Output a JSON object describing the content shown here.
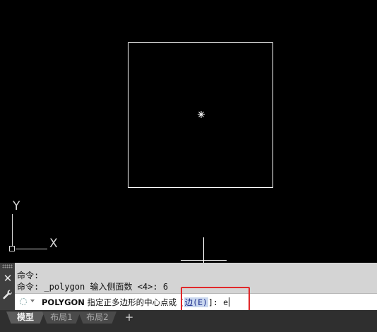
{
  "canvas": {
    "background": "#000000",
    "axis_x_label": "X",
    "axis_y_label": "Y",
    "stroke_color": "#ffffff"
  },
  "command_panel": {
    "history": [
      "命令:",
      "命令: _polygon 输入侧面数 <4>: 6"
    ],
    "prompt": {
      "command": "POLYGON",
      "text": "指定正多边形的中心点或",
      "bracket_open": "[",
      "option_label": "边",
      "option_key": "(E)",
      "bracket_close": "]:",
      "typed": "e"
    },
    "highlight_color": "#e0282a"
  },
  "layout_tabs": {
    "tabs": [
      {
        "label": "模型",
        "active": true
      },
      {
        "label": "布局1",
        "active": false
      },
      {
        "label": "布局2",
        "active": false
      }
    ],
    "add_label": "+"
  }
}
